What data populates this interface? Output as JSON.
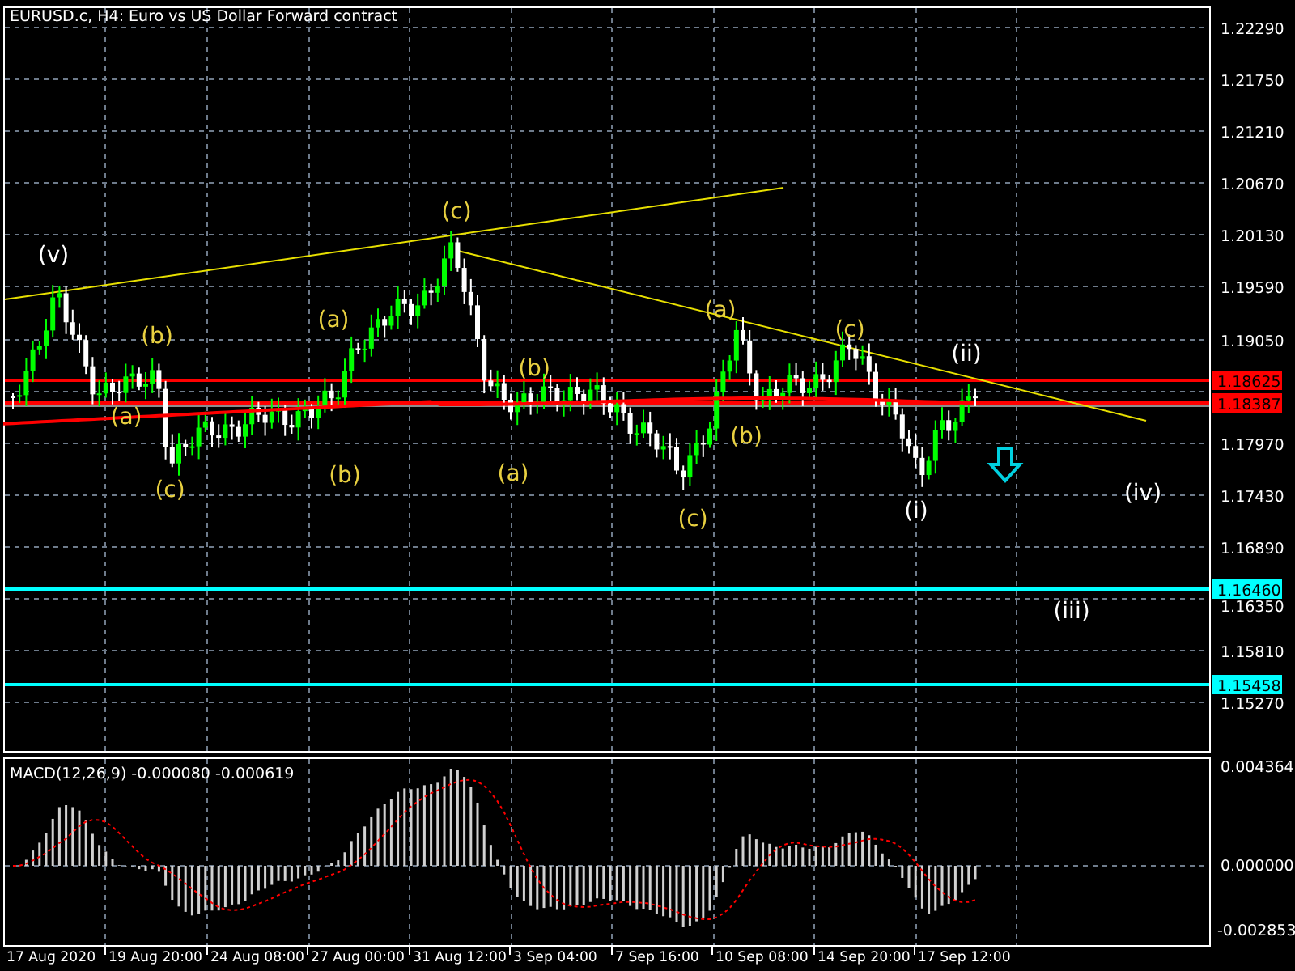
{
  "title": "EURUSD.c, H4:  Euro vs US Dollar Forward contract",
  "price_axis": [
    "1.22290",
    "1.21750",
    "1.21210",
    "1.20670",
    "1.20130",
    "1.19590",
    "1.19050",
    "1.17970",
    "1.17430",
    "1.16890",
    "1.16350",
    "1.15810",
    "1.15270"
  ],
  "price_levels": [
    {
      "label": "1.18625",
      "color": "#ff0000"
    },
    {
      "label": "1.18387",
      "color": "#ff0000"
    },
    {
      "label": "1.16460",
      "color": "#00ffff"
    },
    {
      "label": "1.15458",
      "color": "#00ffff"
    }
  ],
  "wave_labels": [
    {
      "text": "(v)",
      "color": "#ffffff"
    },
    {
      "text": "(b)",
      "color": "#e8d040"
    },
    {
      "text": "(a)",
      "color": "#e8d040"
    },
    {
      "text": "(c)",
      "color": "#e8d040"
    },
    {
      "text": "(a)",
      "color": "#e8d040"
    },
    {
      "text": "(b)",
      "color": "#e8d040"
    },
    {
      "text": "(c)",
      "color": "#e8d040"
    },
    {
      "text": "(b)",
      "color": "#e8d040"
    },
    {
      "text": "(a)",
      "color": "#e8d040"
    },
    {
      "text": "(a)",
      "color": "#e8d040"
    },
    {
      "text": "(b)",
      "color": "#e8d040"
    },
    {
      "text": "(c)",
      "color": "#e8d040"
    },
    {
      "text": "(c)",
      "color": "#e8d040"
    },
    {
      "text": "(ii)",
      "color": "#ffffff"
    },
    {
      "text": "(i)",
      "color": "#ffffff"
    },
    {
      "text": "(iv)",
      "color": "#ffffff"
    },
    {
      "text": "(iii)",
      "color": "#ffffff"
    }
  ],
  "macd": {
    "label": "MACD(12,26,9) -0.000080 -0.000619",
    "axis": [
      "0.004364",
      "0.000000",
      "-0.002853"
    ]
  },
  "time_axis": [
    "17 Aug 2020",
    "19 Aug 20:00",
    "24 Aug 08:00",
    "27 Aug 00:00",
    "31 Aug 12:00",
    "3 Sep 04:00",
    "7 Sep 16:00",
    "10 Sep 08:00",
    "14 Sep 20:00",
    "17 Sep 12:00"
  ]
}
